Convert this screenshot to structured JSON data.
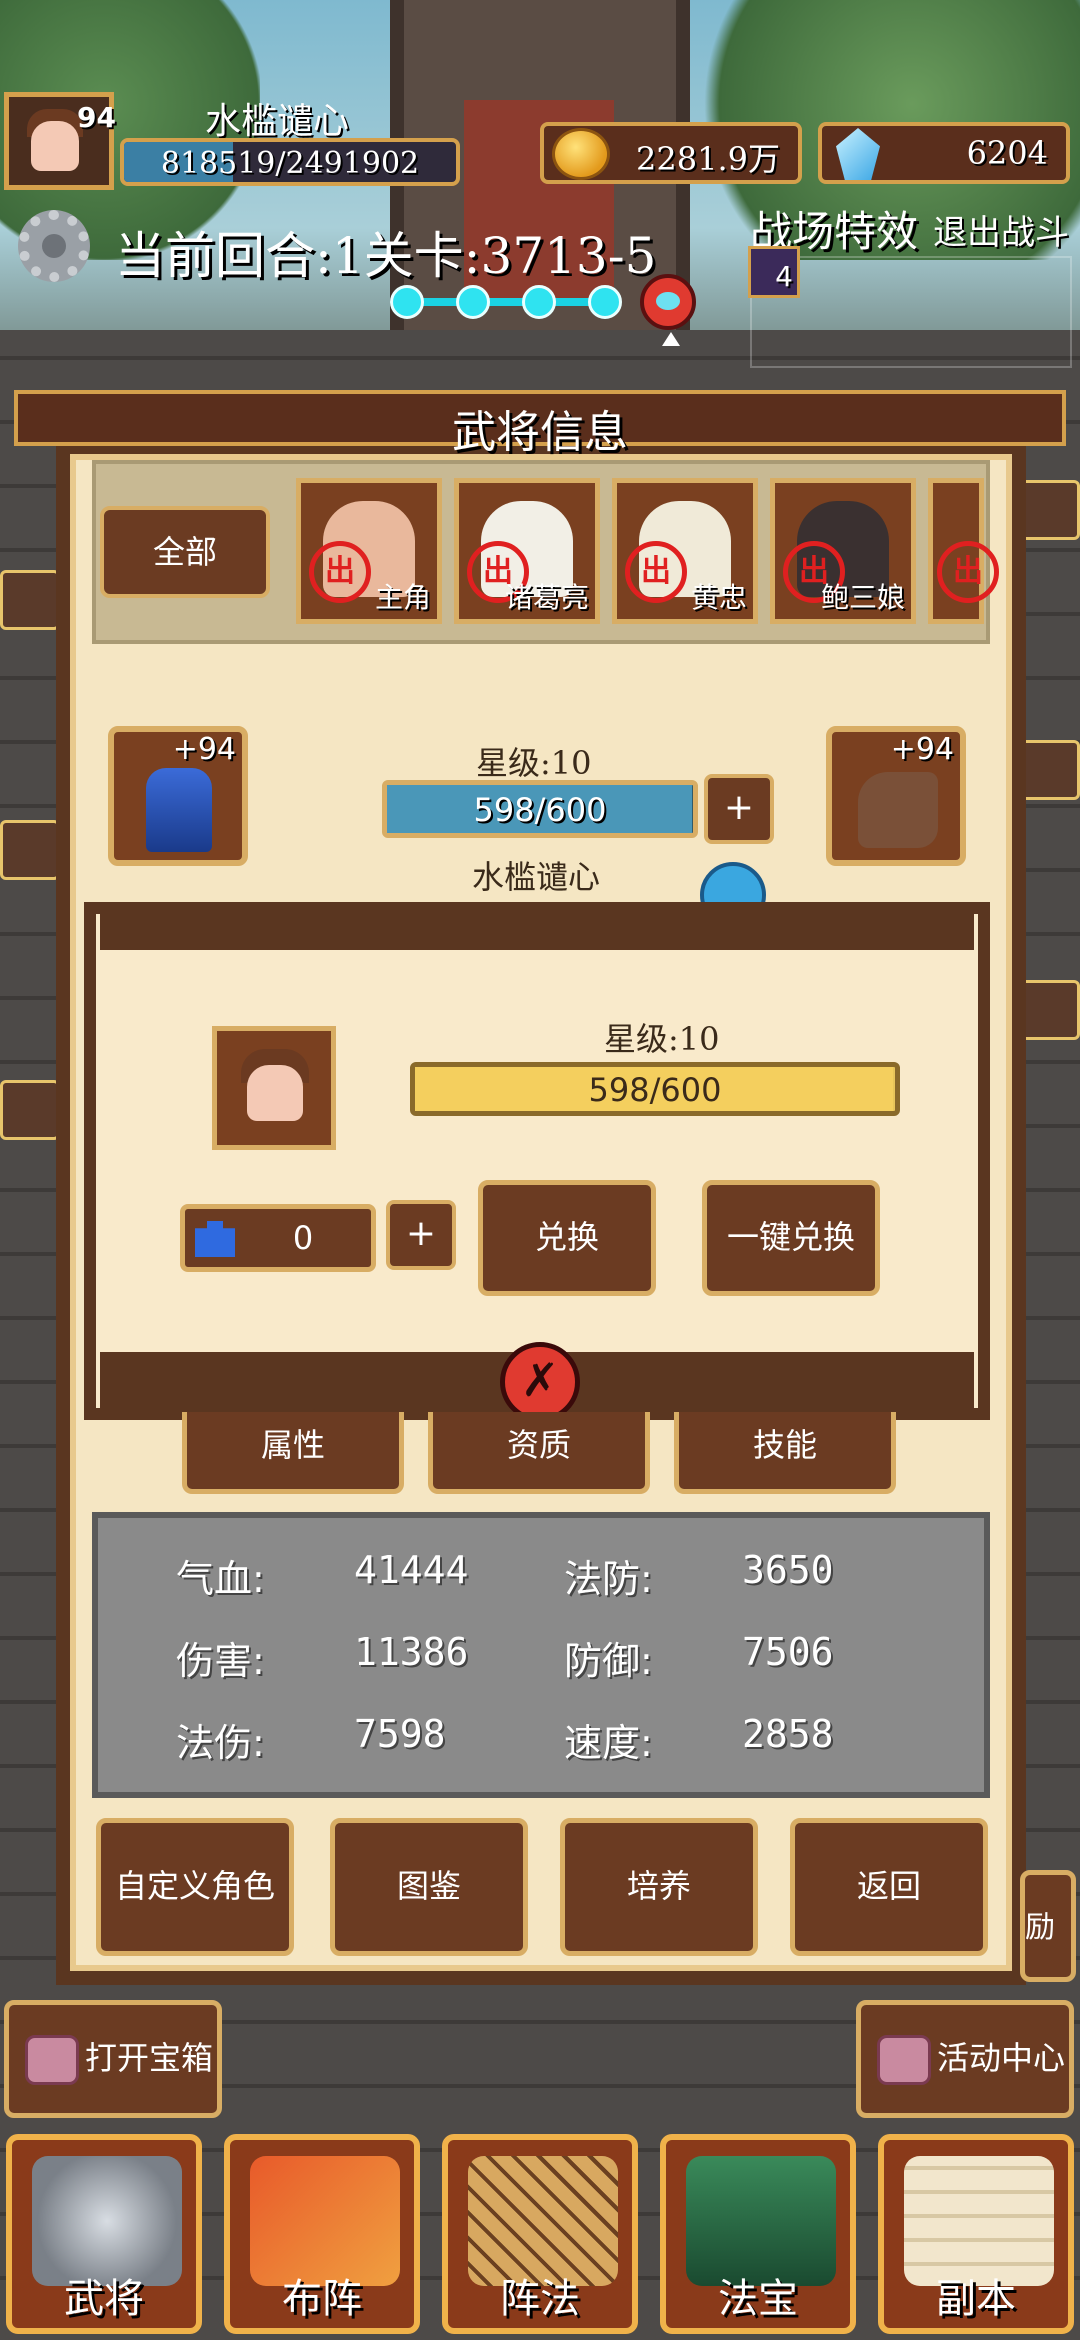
{
  "player": {
    "level": "94",
    "name": "水槛谴心",
    "hp_text": "818519/2491902",
    "hp_current": 818519,
    "hp_max": 2491902
  },
  "currency": {
    "gold": "2281.9万",
    "gems": "6204"
  },
  "battle": {
    "round_text": "当前回合:1关卡:3713-5",
    "effect_label": "战场特效",
    "quit_label": "退出战斗",
    "effect_count": "4",
    "progress_stage": 4,
    "progress_total": 5
  },
  "panel": {
    "title": "武将信息",
    "filter_all": "全部",
    "heroes": [
      {
        "name": "主角",
        "stamp": "出"
      },
      {
        "name": "诸葛亮",
        "stamp": "出"
      },
      {
        "name": "黄忠",
        "stamp": "出"
      },
      {
        "name": "鲍三娘",
        "stamp": "出"
      },
      {
        "name": "",
        "stamp": "出"
      }
    ],
    "armor_level": "+94",
    "weapon_level": "+94",
    "star_label": "星级:10",
    "exp_text": "598/600",
    "exp_current": 598,
    "exp_max": 600,
    "plus": "+",
    "hero_name": "水槛谴心"
  },
  "popup": {
    "star_label": "星级:10",
    "exp_text": "598/600",
    "exp_current": 598,
    "exp_max": 600,
    "shard_count": "0",
    "plus": "+",
    "exchange": "兑换",
    "exchange_all": "一键兑换",
    "close_symbol": "✗"
  },
  "tabs": [
    "属性",
    "资质",
    "技能"
  ],
  "stats": {
    "hp_label": "气血:",
    "hp_value": "41444",
    "mdef_label": "法防:",
    "mdef_value": "3650",
    "atk_label": "伤害:",
    "atk_value": "11386",
    "def_label": "防御:",
    "def_value": "7506",
    "matk_label": "法伤:",
    "matk_value": "7598",
    "spd_label": "速度:",
    "spd_value": "2858"
  },
  "actions": {
    "custom": "自定义角色",
    "codex": "图鉴",
    "train": "培养",
    "back": "返回"
  },
  "side": {
    "open_chest": "打开宝箱",
    "activity": "活动中心",
    "reward_partial": "励"
  },
  "nav": [
    "武将",
    "布阵",
    "阵法",
    "法宝",
    "副本"
  ],
  "colors": {
    "frame": "#5a3620",
    "gold_border": "#d8ad64",
    "button": "#6b3b22",
    "parchment": "#f5e6c3",
    "accent_red": "#e02020"
  }
}
